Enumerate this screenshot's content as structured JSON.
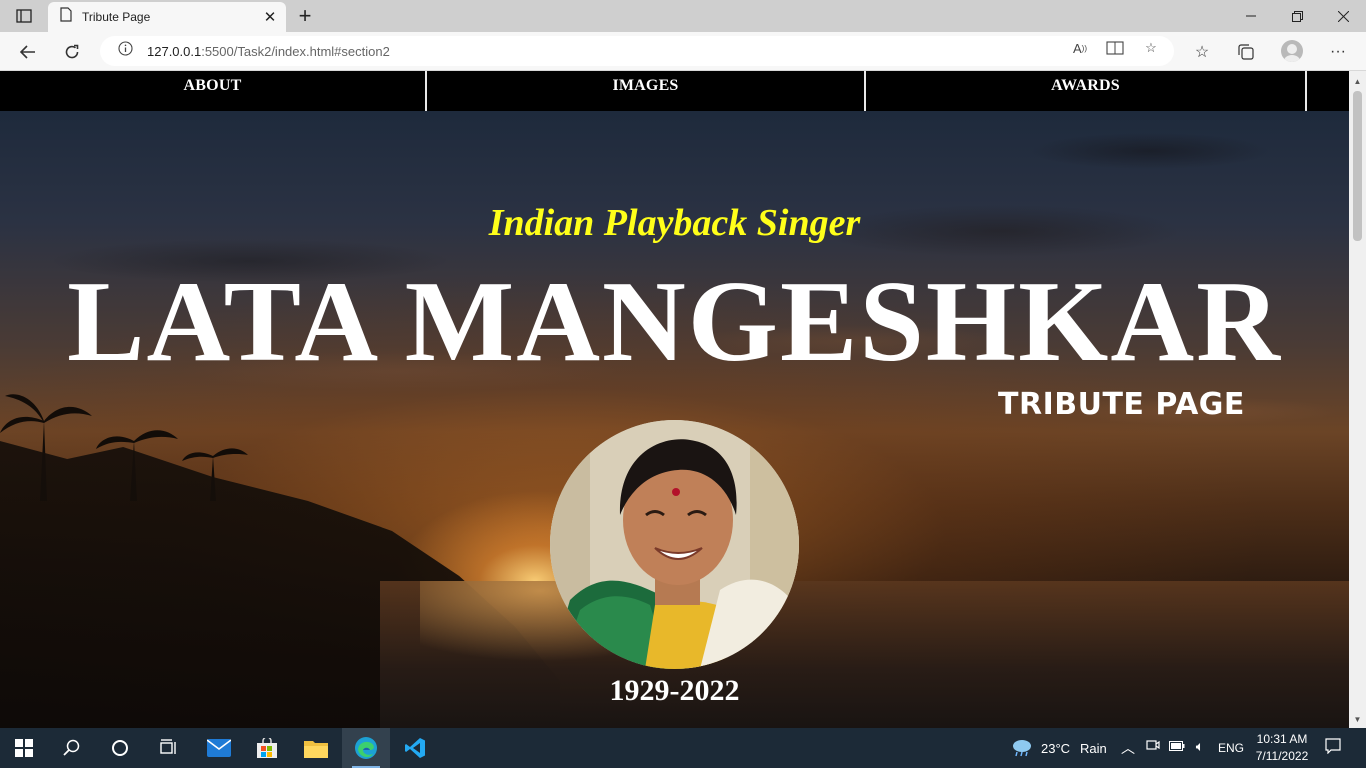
{
  "browser": {
    "tab_title": "Tribute Page",
    "url_host": "127.0.0.1",
    "url_rest": ":5500/Task2/index.html#section2"
  },
  "page": {
    "nav": [
      "ABOUT",
      "IMAGES",
      "AWARDS"
    ],
    "subtitle": "Indian Playback Singer",
    "title": "LATA MANGESHKAR",
    "tribute_label": "TRIBUTE PAGE",
    "years": "1929-2022"
  },
  "taskbar": {
    "weather": "23°C",
    "weather_desc": "Rain",
    "language": "ENG",
    "time": "10:31 AM",
    "date": "7/11/2022"
  },
  "colors": {
    "subtitle": "#ffff1a",
    "navbar_bg": "#000000",
    "taskbar_bg": "#1c2a37"
  }
}
